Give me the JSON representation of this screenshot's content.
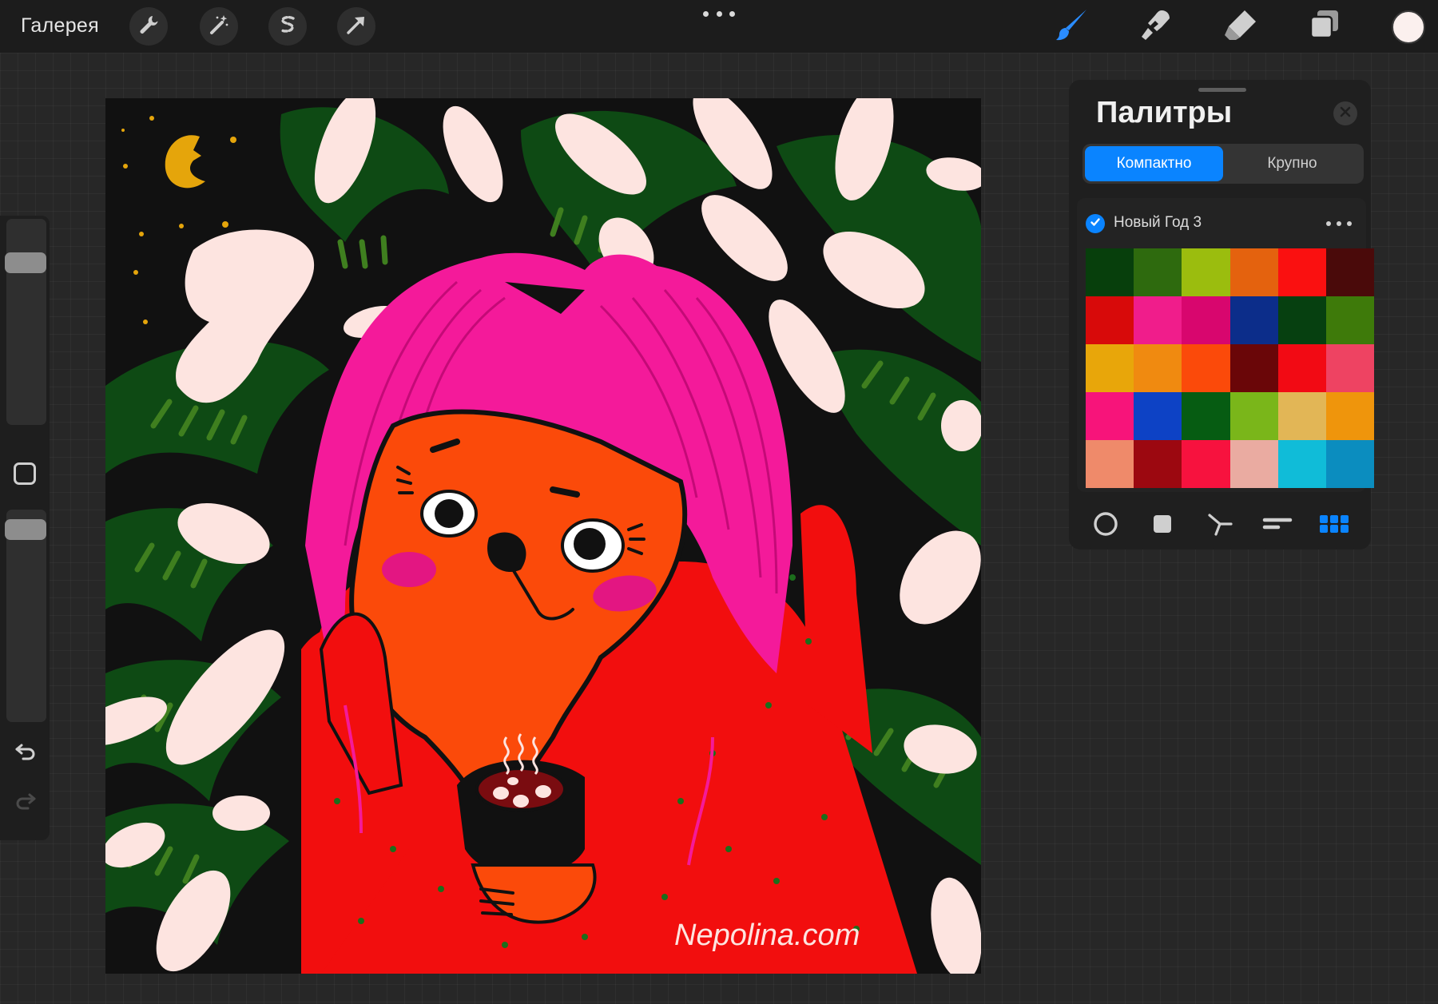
{
  "topbar": {
    "gallery_label": "Галерея",
    "tools_left": [
      "wrench-icon",
      "magic-wand-icon",
      "selection-s-icon",
      "transform-arrow-icon"
    ],
    "tools_right": [
      "brush-icon",
      "smudge-icon",
      "eraser-icon",
      "layers-icon"
    ],
    "active_tool": "brush",
    "current_color": "#fbf0ee"
  },
  "sidebar": {
    "brush_size": 0.82,
    "brush_opacity": 0.95
  },
  "canvas": {
    "watermark": "Nepolina.com"
  },
  "palettes_panel": {
    "title": "Палитры",
    "view_modes": [
      "Компактно",
      "Крупно"
    ],
    "active_view": "Компактно",
    "palette": {
      "name": "Новый Год 3",
      "is_default": true,
      "colors": [
        "#073f0c",
        "#2e6a0e",
        "#9bbd0e",
        "#e4620e",
        "#fa1010",
        "#4a0a0a",
        "#d80a0a",
        "#f01d8b",
        "#d8066e",
        "#0c2d8a",
        "#064010",
        "#3e7a0a",
        "#e8a60a",
        "#f08a10",
        "#fb4a0a",
        "#6a0608",
        "#f20a14",
        "#ee4362",
        "#f7147a",
        "#0d42c5",
        "#065c12",
        "#7ab61a",
        "#e2b656",
        "#ef950c",
        "#ef8a6a",
        "#9c0810",
        "#f7123e",
        "#eaaba1",
        "#10bcd8",
        "#0b8dbf"
      ]
    },
    "bottom_tabs": [
      "disc-icon",
      "square-icon",
      "harmony-icon",
      "value-sliders-icon",
      "palettes-grid-icon"
    ],
    "active_bottom_tab": "palettes-grid-icon"
  },
  "colors": {
    "accent": "#0a84ff",
    "ui_background": "#272727",
    "toolbar": "#1c1c1c"
  }
}
